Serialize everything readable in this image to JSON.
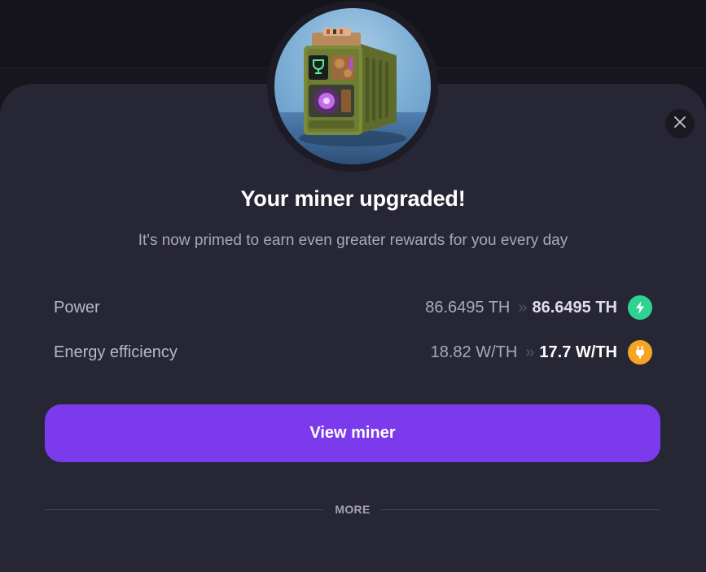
{
  "modal": {
    "title": "Your miner upgraded!",
    "subtitle": "It's now primed to earn even greater rewards for you every day",
    "close_icon": "close-icon",
    "miner_image": "miner-image"
  },
  "stats": [
    {
      "label": "Power",
      "old_value": "86.6495 TH",
      "separator": "»",
      "new_value": "86.6495 TH",
      "icon": "lightning-icon",
      "icon_color": "#2fd38f"
    },
    {
      "label": "Energy efficiency",
      "old_value": "18.82 W/TH",
      "separator": "»",
      "new_value": "17.7 W/TH",
      "icon": "plug-icon",
      "icon_color": "#f5a524"
    }
  ],
  "cta": {
    "label": "View miner"
  },
  "more": {
    "label": "MORE"
  },
  "colors": {
    "accent": "#7c3aed",
    "sheet": "#272635",
    "background": "#17161f"
  }
}
